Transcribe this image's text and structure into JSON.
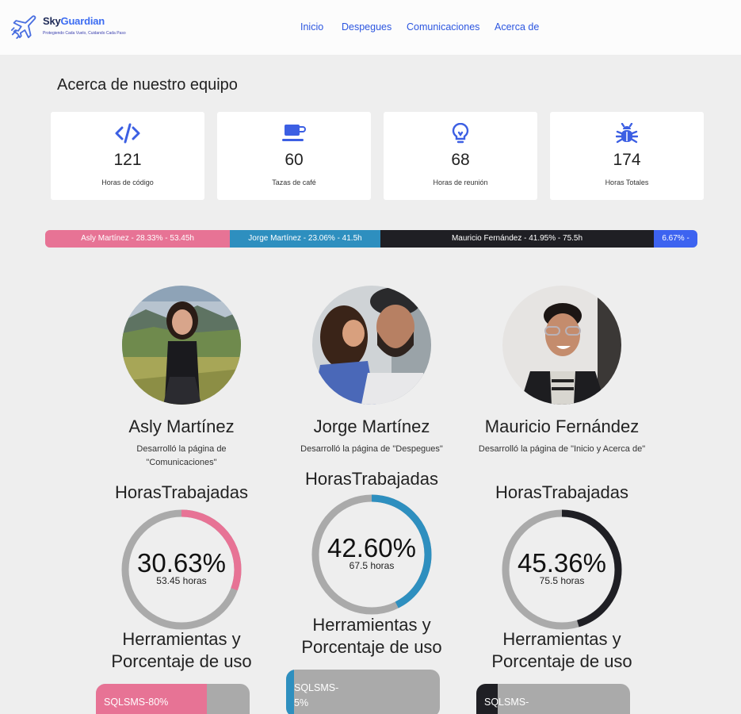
{
  "header": {
    "brand_part1": "Sky",
    "brand_part2": "Guardian",
    "tagline": "Protegiendo Cada Vuelo, Cuidando Cada Paso",
    "nav": [
      "Inicio",
      "Despegues",
      "Comunicaciones",
      "Acerca de"
    ]
  },
  "page_title": "Acerca de nuestro equipo",
  "stats": [
    {
      "icon": "code-icon",
      "value": "121",
      "label": "Horas de código"
    },
    {
      "icon": "coffee-cup-icon",
      "value": "60",
      "label": "Tazas de café"
    },
    {
      "icon": "lightbulb-icon",
      "value": "68",
      "label": "Horas de reunión"
    },
    {
      "icon": "bug-icon",
      "value": "174",
      "label": "Horas Totales"
    }
  ],
  "progress": [
    {
      "label": "Asly Martínez - 28.33% - 53.45h",
      "percent": 28.33,
      "color": "#e77395"
    },
    {
      "label": "Jorge Martínez - 23.06% - 41.5h",
      "percent": 23.06,
      "color": "#2e8fbf"
    },
    {
      "label": "Mauricio Fernández - 41.95% - 75.5h",
      "percent": 41.95,
      "color": "#1f1f24"
    },
    {
      "label": "6.67% -",
      "percent": 6.67,
      "color": "#3d63f0"
    }
  ],
  "members": [
    {
      "name": "Asly Martínez",
      "desc": "Desarrolló la página de \"Comunicaciones\"",
      "hours_title": "HorasTrabajadas",
      "percent_text": "30.63%",
      "percent": 30.63,
      "hours_text": "53.45 horas",
      "color": "#e77395",
      "tools_title": "Herramientas y Porcentaje de uso",
      "tool_label": "SQLSMS-80%",
      "tool_percent": 72
    },
    {
      "name": "Jorge Martínez",
      "desc": "Desarrolló la página de \"Despegues\"",
      "hours_title": "HorasTrabajadas",
      "percent_text": "42.60%",
      "percent": 42.6,
      "hours_text": "67.5 horas",
      "color": "#2e8fbf",
      "tools_title": "Herramientas y Porcentaje de uso",
      "tool_label": "SQLSMS-5%",
      "tool_percent": 5
    },
    {
      "name": "Mauricio Fernández",
      "desc": "Desarrolló la página de \"Inicio y Acerca de\"",
      "hours_title": "HorasTrabajadas",
      "percent_text": "45.36%",
      "percent": 45.36,
      "hours_text": "75.5 horas",
      "color": "#1f1f24",
      "tools_title": "Herramientas y Porcentaje de uso",
      "tool_label": "SQLSMS-",
      "tool_percent": 14
    }
  ]
}
